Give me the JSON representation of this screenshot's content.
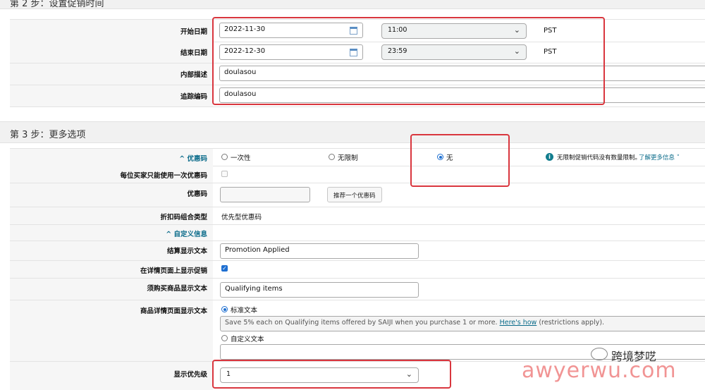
{
  "step2": {
    "title": "第 2 步：设置促销时间",
    "rows": {
      "start_label": "开始日期",
      "start_date": "2022-11-30",
      "start_time": "11:00",
      "start_tz": "PST",
      "end_label": "结束日期",
      "end_date": "2022-12-30",
      "end_time": "23:59",
      "end_tz": "PST",
      "desc_label": "内部描述",
      "desc_value": "doulasou",
      "track_label": "追踪编码",
      "track_value": "doulasou"
    }
  },
  "step3": {
    "title": "第 3 步：更多选项",
    "coupon_section": "^ 优惠码",
    "coupon_options": [
      "一次性",
      "无限制",
      "无"
    ],
    "coupon_selected": "无",
    "coupon_info": "无限制促销代码没有数量限制。",
    "coupon_info_link": "了解更多信息 ˅",
    "once_per_buyer_label": "每位买家只能使用一次优惠码",
    "coupon_code_label": "优惠码",
    "coupon_code_value": "",
    "suggest_button": "推荐一个优惠码",
    "combo_label": "折扣码组合类型",
    "combo_value": "优先型优惠码",
    "custom_section": "^ 自定义信息",
    "checkout_label": "结算显示文本",
    "checkout_value": "Promotion Applied",
    "detail_page_label": "在详情页面上显示促销",
    "detail_page_checked": true,
    "qualifying_label": "须购买商品显示文本",
    "qualifying_value": "Qualifying items",
    "product_text_label": "商品详情页面显示文本",
    "standard_text_option": "标准文本",
    "standard_text_preview": "Save 5% each on Qualifying items offered by SAIJI when you purchase 1 or more.",
    "standard_text_link": "Here's how",
    "standard_text_suffix": "(restrictions apply).",
    "custom_text_option": "自定义文本",
    "custom_text_value": "",
    "priority_label": "显示优先级",
    "priority_value": "1"
  },
  "watermark": {
    "line1": "跨境梦呓",
    "line2": "awyerwu.com"
  },
  "colors": {
    "highlight": "#d9363e",
    "accent": "#1e6fd1",
    "link": "#0a6b8a"
  }
}
